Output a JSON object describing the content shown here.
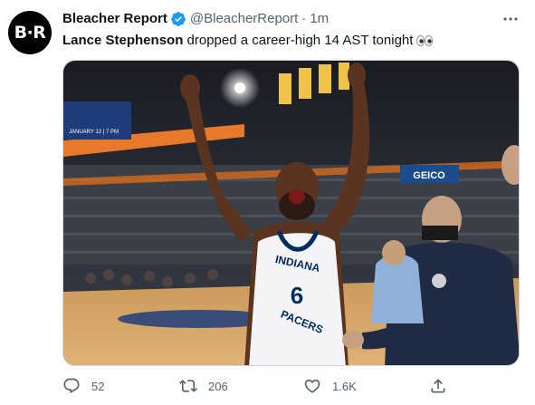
{
  "author": {
    "avatar_text": "B·R",
    "display_name": "Bleacher Report",
    "handle": "@BleacherReport",
    "separator": "·",
    "time": "1m",
    "verified": true
  },
  "tweet": {
    "text_bold": "Lance Stephenson",
    "text_rest": " dropped a career-high 14 AST tonight",
    "emoji": "eyes-emoji"
  },
  "media": {
    "jersey_line1": "INDIANA",
    "jersey_line2": "PACERS",
    "jersey_number": "6",
    "arena_sign": "GEICO",
    "sign_left": "JANUARY 12 | 7 PM"
  },
  "actions": {
    "reply_count": "52",
    "retweet_count": "206",
    "like_count": "1.6K"
  },
  "colors": {
    "text_primary": "#0f1419",
    "text_secondary": "#536471",
    "verified_blue": "#1d9bf0",
    "pacers_navy": "#002d62",
    "pacers_gold": "#fdbb30"
  }
}
